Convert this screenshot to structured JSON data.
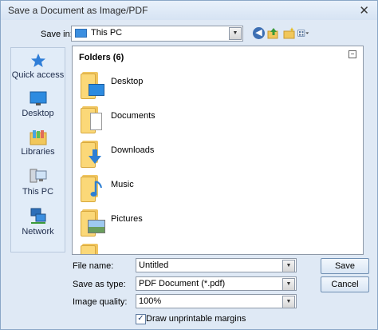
{
  "window": {
    "title": "Save a Document as Image/PDF",
    "close_glyph": "✕"
  },
  "toolbar": {
    "save_in_label": "Save in:",
    "save_in_value": "This PC"
  },
  "sidebar": {
    "items": [
      {
        "label": "Quick access",
        "icon": "star-icon"
      },
      {
        "label": "Desktop",
        "icon": "desktop-icon"
      },
      {
        "label": "Libraries",
        "icon": "libraries-icon"
      },
      {
        "label": "This PC",
        "icon": "computer-icon"
      },
      {
        "label": "Network",
        "icon": "network-icon"
      }
    ]
  },
  "filelist": {
    "group_title": "Folders (6)",
    "folders": [
      {
        "label": "Desktop",
        "icon": "desktop-folder-icon"
      },
      {
        "label": "Documents",
        "icon": "documents-folder-icon"
      },
      {
        "label": "Downloads",
        "icon": "downloads-folder-icon"
      },
      {
        "label": "Music",
        "icon": "music-folder-icon"
      },
      {
        "label": "Pictures",
        "icon": "pictures-folder-icon"
      },
      {
        "label": "",
        "icon": "folder-icon"
      }
    ]
  },
  "form": {
    "file_name_label": "File name:",
    "file_name_value": "Untitled",
    "save_as_type_label": "Save as type:",
    "save_as_type_value": "PDF Document (*.pdf)",
    "image_quality_label": "Image quality:",
    "image_quality_value": "100%",
    "draw_margins_label": "Draw unprintable margins",
    "draw_margins_checked": true
  },
  "buttons": {
    "save": "Save",
    "cancel": "Cancel"
  },
  "colors": {
    "accent": "#3c8fe0",
    "folder": "#fbd878",
    "window_bg": "#dfe9f5"
  }
}
